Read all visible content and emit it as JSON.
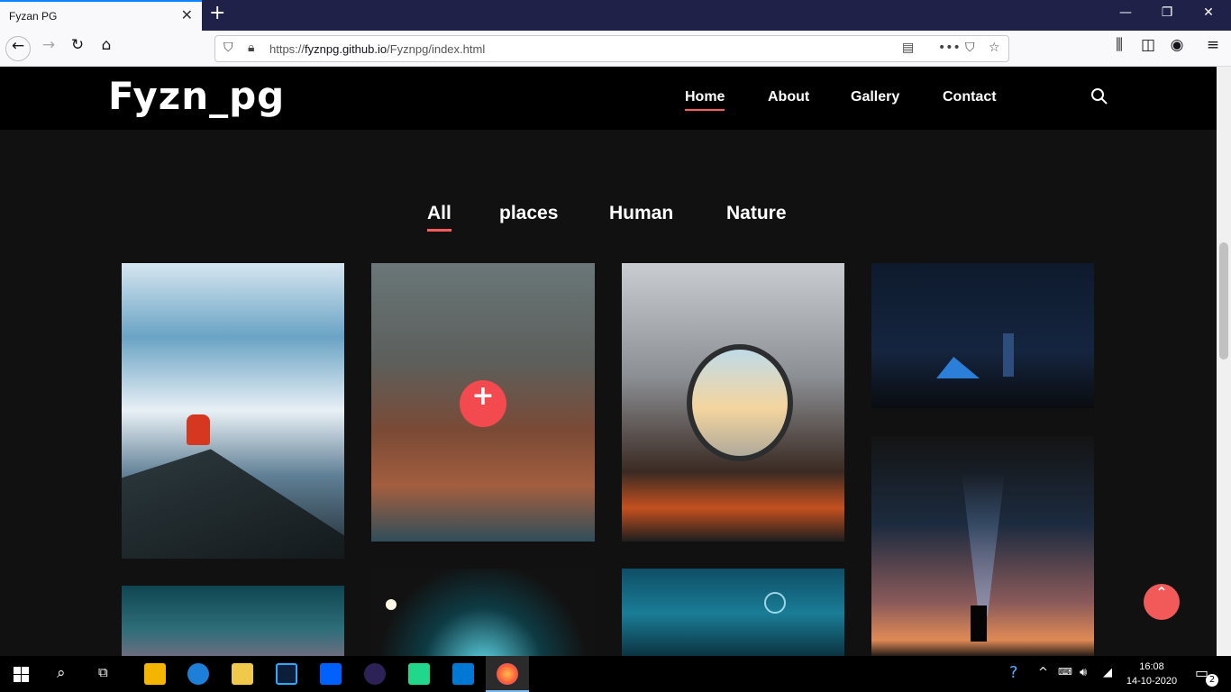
{
  "browser": {
    "tab_title": "Fyzan PG",
    "tab_close": "✕",
    "new_tab": "+",
    "url_prefix": "https://",
    "url_host": "fyznpg.github.io",
    "url_path": "/Fyznpg/index.html",
    "window_controls": [
      "—",
      "❐",
      "✕"
    ]
  },
  "site": {
    "logo": "Fyzn_pg",
    "menu": [
      {
        "label": "Home",
        "active": true
      },
      {
        "label": "About",
        "active": false
      },
      {
        "label": "Gallery",
        "active": false
      },
      {
        "label": "Contact",
        "active": false
      }
    ],
    "filters": [
      {
        "label": "All",
        "active": true
      },
      {
        "label": "places",
        "active": false
      },
      {
        "label": "Human",
        "active": false
      },
      {
        "label": "Nature",
        "active": false
      }
    ],
    "plus_label": "+",
    "to_top_label": "⌃",
    "accent_color": "#ff5c5c"
  },
  "taskbar": {
    "time": "16:08",
    "date": "14-10-2020",
    "notification_count": "2"
  }
}
